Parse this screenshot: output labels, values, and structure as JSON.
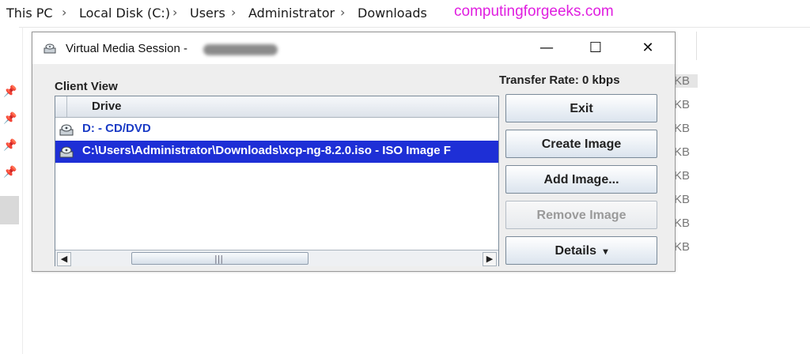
{
  "explorer": {
    "breadcrumb": [
      "This PC",
      "Local Disk (C:)",
      "Users",
      "Administrator",
      "Downloads"
    ],
    "separator": "›",
    "watermark": "computingforgeeks.com",
    "size_column": [
      "KB",
      "KB",
      "KB",
      "KB",
      "KB",
      "KB",
      "KB",
      "KB"
    ]
  },
  "dialog": {
    "title": "Virtual Media Session -",
    "window_controls": {
      "minimize": "—",
      "maximize": "☐",
      "close": "✕"
    },
    "client_view_label": "Client View",
    "column_header": "Drive",
    "drives": [
      {
        "label": "D: - CD/DVD",
        "icon": "drive-icon",
        "selected": false
      },
      {
        "label": "C:\\Users\\Administrator\\Downloads\\xcp-ng-8.2.0.iso - ISO Image F",
        "icon": "drive-icon",
        "selected": true
      }
    ],
    "transfer_rate": "Transfer Rate:  0 kbps",
    "buttons": {
      "exit": "Exit",
      "create_image": "Create Image",
      "add_image": "Add Image...",
      "remove_image": "Remove Image",
      "details": "Details"
    },
    "details_arrow": "▾",
    "scroll_left": "◀",
    "scroll_right": "▶",
    "scroll_grip": "|||"
  },
  "colors": {
    "selection": "#1e2fd6",
    "drive_text": "#1a3bc5",
    "watermark": "#e01ee0"
  }
}
